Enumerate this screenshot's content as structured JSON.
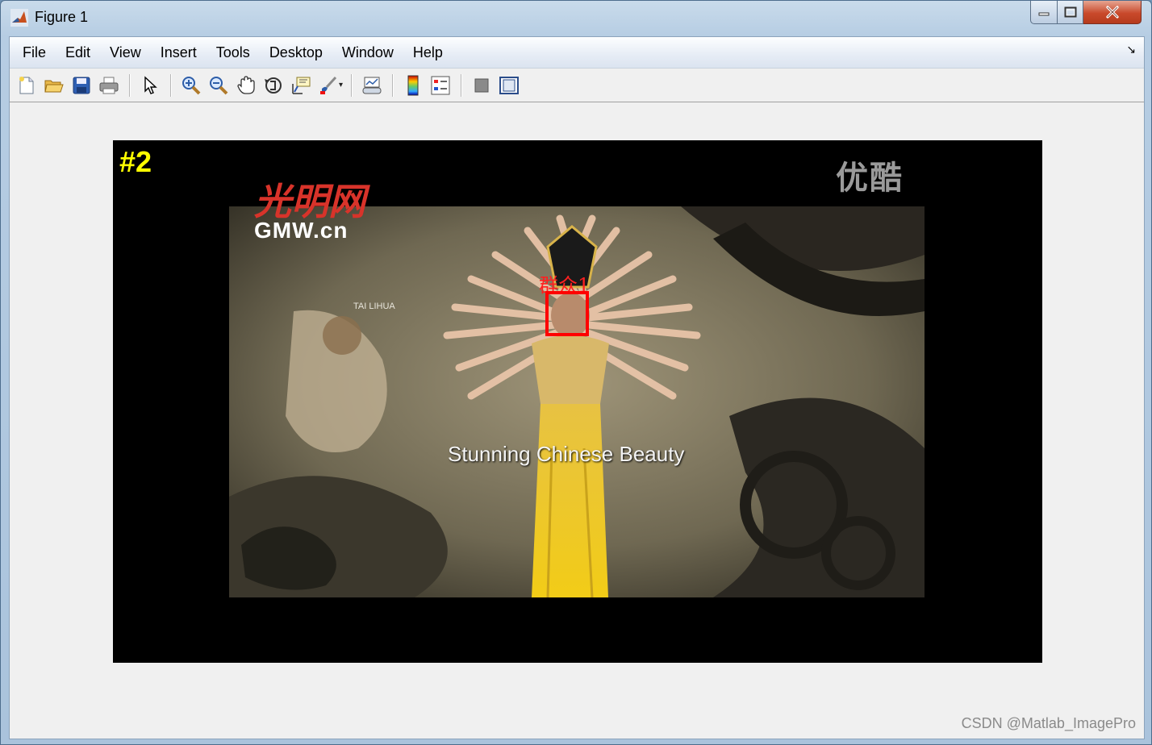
{
  "window": {
    "title": "Figure 1",
    "caption_buttons": [
      "minimize",
      "maximize",
      "close"
    ]
  },
  "menu": {
    "items": [
      "File",
      "Edit",
      "View",
      "Insert",
      "Tools",
      "Desktop",
      "Window",
      "Help"
    ],
    "dock_glyph": "↘"
  },
  "toolbar": {
    "buttons": [
      {
        "icon": "new-figure-icon"
      },
      {
        "icon": "open-file-icon"
      },
      {
        "icon": "save-icon"
      },
      {
        "icon": "print-icon"
      },
      {
        "icon": "edit-plot-arrow-icon"
      },
      {
        "icon": "zoom-in-icon"
      },
      {
        "icon": "zoom-out-icon"
      },
      {
        "icon": "pan-hand-icon"
      },
      {
        "icon": "rotate-3d-icon"
      },
      {
        "icon": "data-cursor-icon"
      },
      {
        "icon": "brush-icon"
      },
      {
        "icon": "link-plot-icon"
      },
      {
        "icon": "colorbar-icon"
      },
      {
        "icon": "legend-icon"
      },
      {
        "icon": "hide-plot-tools-icon"
      },
      {
        "icon": "show-plot-tools-icon"
      }
    ],
    "caret": "▾"
  },
  "figure": {
    "frame_label": "#2",
    "video_logo_cn": "光明网",
    "video_logo_en": "GMW.cn",
    "youku_watermark": "优酷",
    "sign_text": "TAI LIHUA",
    "subtitle": "Stunning Chinese Beauty",
    "face_label": "群众1",
    "colors": {
      "frame_label": "#ffff00",
      "face_box": "#ff0000",
      "axes_bg": "#000000",
      "figure_bg": "#f0f0f0"
    }
  },
  "watermark": "CSDN @Matlab_ImagePro"
}
